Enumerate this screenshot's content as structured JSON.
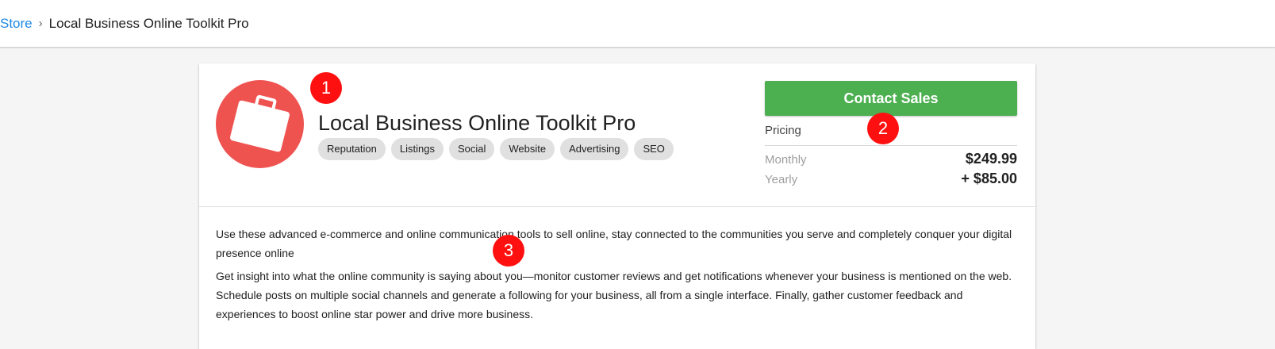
{
  "breadcrumb": {
    "store_label": "Store",
    "separator": "›",
    "current": "Local Business Online Toolkit Pro"
  },
  "product": {
    "title": "Local Business Online Toolkit Pro",
    "logo_icon": "briefcase-icon",
    "logo_color": "#ef5350",
    "tags": [
      "Reputation",
      "Listings",
      "Social",
      "Website",
      "Advertising",
      "SEO"
    ]
  },
  "sidebar": {
    "cta_label": "Contact Sales",
    "cta_color": "#4caf50",
    "pricing_label": "Pricing",
    "prices": [
      {
        "name": "Monthly",
        "value": "$249.99"
      },
      {
        "name": "Yearly",
        "value": "+ $85.00"
      }
    ]
  },
  "description": {
    "paragraphs": [
      "Use these advanced e-commerce and online communication tools to sell online, stay connected to the communities you serve and completely conquer your digital presence online",
      "Get insight into what the online community is saying about you—monitor customer reviews and get notifications whenever your business is mentioned on the web. Schedule posts on multiple social channels and generate a following for your business, all from a single interface. Finally, gather customer feedback and experiences to boost online star power and drive more business."
    ]
  },
  "markers": [
    "1",
    "2",
    "3"
  ],
  "colors": {
    "link": "#1e88e5",
    "marker": "#ff1010"
  }
}
